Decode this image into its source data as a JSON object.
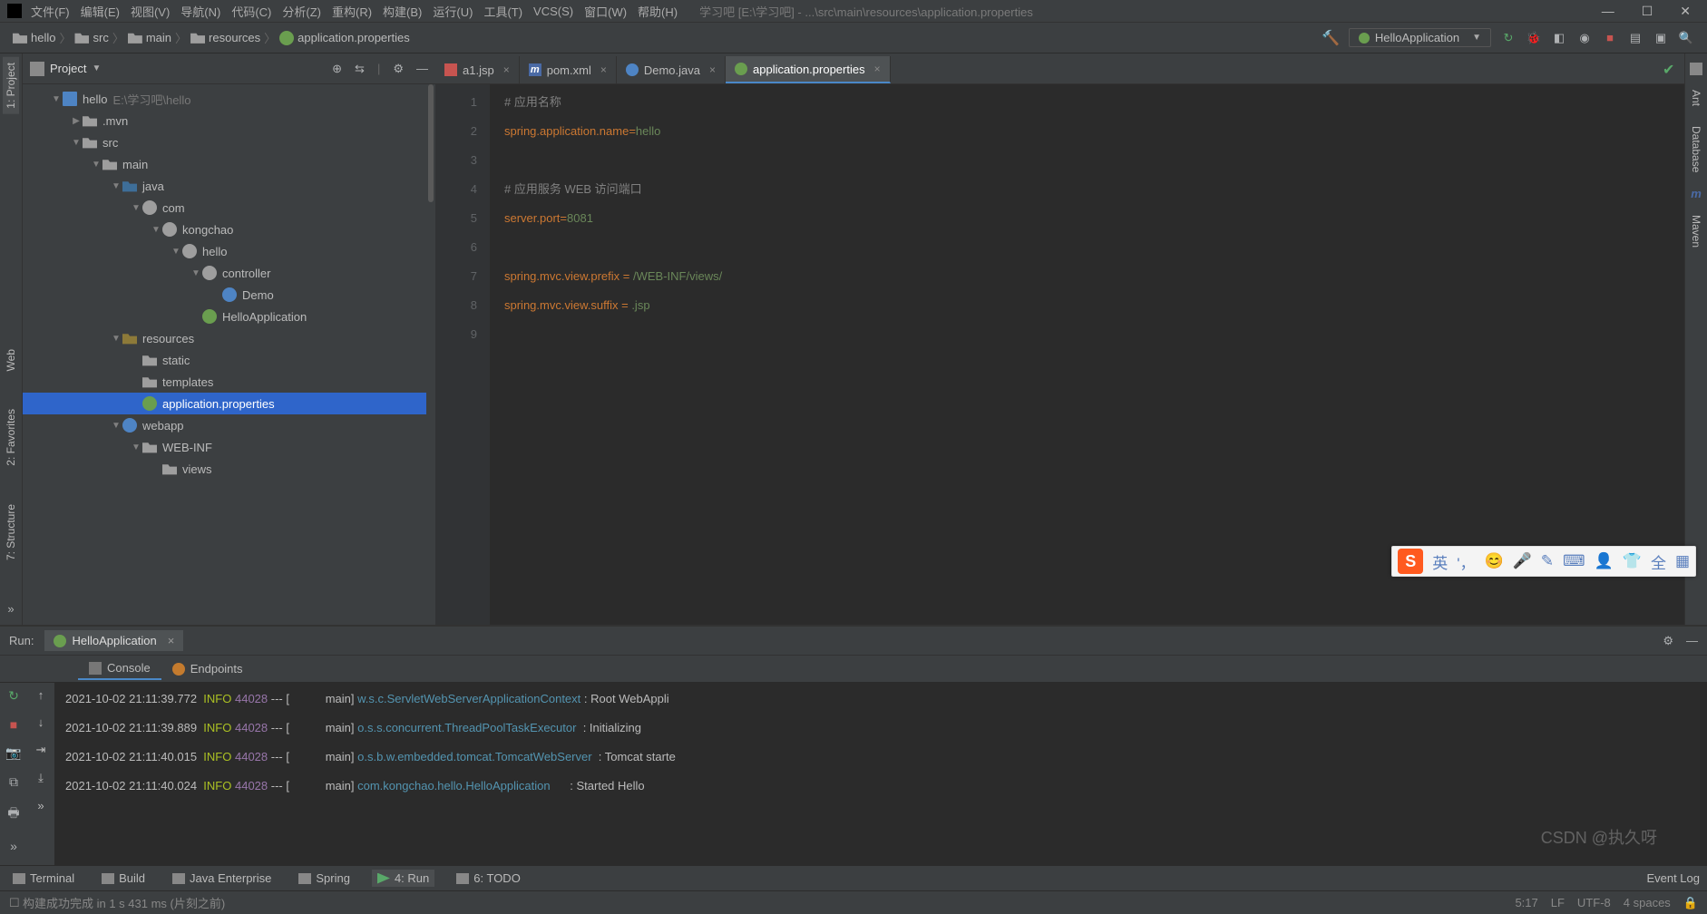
{
  "menu": {
    "file": "文件(F)",
    "edit": "编辑(E)",
    "view": "视图(V)",
    "nav": "导航(N)",
    "code": "代码(C)",
    "analyze": "分析(Z)",
    "refactor": "重构(R)",
    "build": "构建(B)",
    "run": "运行(U)",
    "tools": "工具(T)",
    "vcs": "VCS(S)",
    "window": "窗口(W)",
    "help": "帮助(H)"
  },
  "title": "学习吧 [E:\\学习吧] - ...\\src\\main\\resources\\application.properties",
  "breadcrumb": [
    "hello",
    "src",
    "main",
    "resources",
    "application.properties"
  ],
  "runConfig": "HelloApplication",
  "project": {
    "title": "Project",
    "root": {
      "name": "hello",
      "path": "E:\\学习吧\\hello"
    },
    "nodes": [
      {
        "d": 1,
        "ar": "▼",
        "ico": "ico-mod",
        "txt": "hello",
        "path": "E:\\学习吧\\hello"
      },
      {
        "d": 2,
        "ar": "▶",
        "ico": "ico-fold",
        "txt": ".mvn"
      },
      {
        "d": 2,
        "ar": "▼",
        "ico": "ico-fold",
        "txt": "src"
      },
      {
        "d": 3,
        "ar": "▼",
        "ico": "ico-fold",
        "txt": "main"
      },
      {
        "d": 4,
        "ar": "▼",
        "ico": "ico-src",
        "txt": "java"
      },
      {
        "d": 5,
        "ar": "▼",
        "ico": "ico-pkg",
        "txt": "com"
      },
      {
        "d": 6,
        "ar": "▼",
        "ico": "ico-pkg",
        "txt": "kongchao"
      },
      {
        "d": 7,
        "ar": "▼",
        "ico": "ico-pkg",
        "txt": "hello"
      },
      {
        "d": 8,
        "ar": "▼",
        "ico": "ico-pkg",
        "txt": "controller"
      },
      {
        "d": 9,
        "ar": "",
        "ico": "ico-class",
        "txt": "Demo"
      },
      {
        "d": 8,
        "ar": "",
        "ico": "ico-boot",
        "txt": "HelloApplication"
      },
      {
        "d": 4,
        "ar": "▼",
        "ico": "ico-res",
        "txt": "resources"
      },
      {
        "d": 5,
        "ar": "",
        "ico": "ico-fold",
        "txt": "static"
      },
      {
        "d": 5,
        "ar": "",
        "ico": "ico-fold",
        "txt": "templates"
      },
      {
        "d": 5,
        "ar": "",
        "ico": "ico-boot",
        "txt": "application.properties",
        "sel": true
      },
      {
        "d": 4,
        "ar": "▼",
        "ico": "ico-web",
        "txt": "webapp"
      },
      {
        "d": 5,
        "ar": "▼",
        "ico": "ico-fold",
        "txt": "WEB-INF"
      },
      {
        "d": 6,
        "ar": "",
        "ico": "ico-fold",
        "txt": "views"
      }
    ]
  },
  "tabs": [
    {
      "ico": "i-jsp",
      "label": "a1.jsp"
    },
    {
      "ico": "i-m",
      "glyph": "m",
      "label": "pom.xml"
    },
    {
      "ico": "i-c",
      "label": "Demo.java"
    },
    {
      "ico": "i-p",
      "label": "application.properties",
      "active": true
    }
  ],
  "code": [
    {
      "n": "1",
      "p": [
        {
          "c": "c-com",
          "t": "# 应用名称"
        }
      ]
    },
    {
      "n": "2",
      "p": [
        {
          "c": "c-key",
          "t": "spring.application.name"
        },
        {
          "c": "c-eq",
          "t": "="
        },
        {
          "c": "c-val",
          "t": "hello"
        }
      ]
    },
    {
      "n": "3",
      "p": []
    },
    {
      "n": "4",
      "p": [
        {
          "c": "c-com",
          "t": "# 应用服务 WEB 访问端口"
        }
      ]
    },
    {
      "n": "5",
      "p": [
        {
          "c": "c-key",
          "t": "server.port"
        },
        {
          "c": "c-eq",
          "t": "="
        },
        {
          "c": "c-val",
          "t": "8081"
        }
      ]
    },
    {
      "n": "6",
      "p": []
    },
    {
      "n": "7",
      "p": [
        {
          "c": "c-key",
          "t": "spring.mvc.view.prefix"
        },
        {
          "c": "",
          "t": " "
        },
        {
          "c": "c-eq",
          "t": "="
        },
        {
          "c": "",
          "t": " "
        },
        {
          "c": "c-val",
          "t": "/WEB-INF/views/"
        }
      ]
    },
    {
      "n": "8",
      "p": [
        {
          "c": "c-key",
          "t": "spring.mvc.view.suffix"
        },
        {
          "c": "",
          "t": " "
        },
        {
          "c": "c-eq",
          "t": "="
        },
        {
          "c": "",
          "t": " "
        },
        {
          "c": "c-val",
          "t": ".jsp"
        }
      ]
    },
    {
      "n": "9",
      "p": []
    }
  ],
  "run": {
    "label": "Run:",
    "tab": "HelloApplication",
    "sub": {
      "console": "Console",
      "endpoints": "Endpoints"
    },
    "log": [
      {
        "ts": "2021-10-02 21:11:39.772",
        "lvl": "INFO",
        "pid": "44028",
        "th": "main",
        "cls": "w.s.c.ServletWebServerApplicationContext",
        "msg": "Root WebAppli"
      },
      {
        "ts": "2021-10-02 21:11:39.889",
        "lvl": "INFO",
        "pid": "44028",
        "th": "main",
        "cls": "o.s.s.concurrent.ThreadPoolTaskExecutor",
        "msg": "Initializing "
      },
      {
        "ts": "2021-10-02 21:11:40.015",
        "lvl": "INFO",
        "pid": "44028",
        "th": "main",
        "cls": "o.s.b.w.embedded.tomcat.TomcatWebServer",
        "msg": "Tomcat starte"
      },
      {
        "ts": "2021-10-02 21:11:40.024",
        "lvl": "INFO",
        "pid": "44028",
        "th": "main",
        "cls": "com.kongchao.hello.HelloApplication",
        "msg": "Started Hello"
      }
    ]
  },
  "botTabs": {
    "terminal": "Terminal",
    "build": "Build",
    "je": "Java Enterprise",
    "spring": "Spring",
    "run": "4: Run",
    "todo": "6: TODO",
    "event": "Event Log"
  },
  "leftBar": {
    "project": "1: Project",
    "fav": "2: Favorites",
    "struct": "7: Structure",
    "web": "Web"
  },
  "rightBar": {
    "ant": "Ant",
    "db": "Database",
    "maven": "Maven"
  },
  "status": {
    "build": "构建成功完成 in 1 s 431 ms (片刻之前)",
    "pos": "5:17",
    "lf": "LF",
    "enc": "UTF-8",
    "indent": "4 spaces"
  },
  "ime": {
    "lang": "英",
    "comma": "'，",
    "full": "全"
  },
  "watermark": "CSDN @执久呀"
}
